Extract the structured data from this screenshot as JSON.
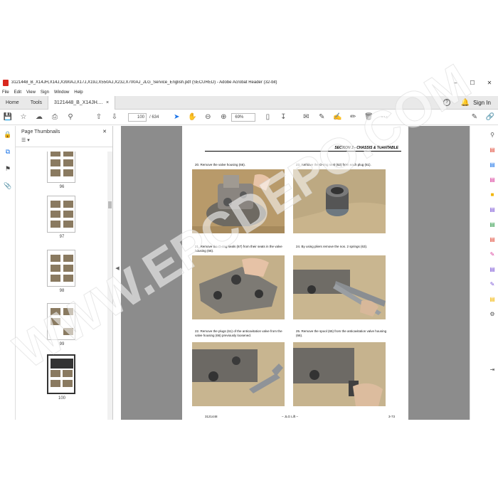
{
  "window": {
    "title": "3121448_B_X14JH,X14J,X390AJ,X17J,X19J,X550AJ,X23J,X700AJ_JLG_Service_English.pdf (SECURED) - Adobe Acrobat Reader (32-bit)",
    "minimize": "–",
    "maximize": "☐",
    "close": "✕"
  },
  "menu": [
    "File",
    "Edit",
    "View",
    "Sign",
    "Window",
    "Help"
  ],
  "tabs": {
    "home": "Home",
    "tools": "Tools",
    "doc": "3121448_B_X14JH....",
    "doc_close": "×",
    "help": "?",
    "signin": "Sign In"
  },
  "toolbar": {
    "page_current": "100",
    "page_total": "/ 634",
    "zoom": "69%"
  },
  "thumbnails": {
    "title": "Page Thumbnails",
    "close": "✕",
    "options": "☰ ▾",
    "pages": [
      "96",
      "97",
      "98",
      "99",
      "100"
    ]
  },
  "document": {
    "section": "SECTION 3 - CHASSIS & TURNTABLE",
    "steps": [
      {
        "text": "20. Remove the valve housing (66)."
      },
      {
        "text": "23. Remove the O-ring seal (62) from each plug (61)."
      },
      {
        "text": "21. Remove the O-ring seals (67) from their seats in the valve housing (66)."
      },
      {
        "text": "24. By using pliers remove the nos. 2 springs (63)."
      },
      {
        "text": "22. Remove the plugs (61) of the anticavitation valve from the valve housing (66) previously loosened."
      },
      {
        "text": "25. Remove the spool (65) from the anticavitation valve housing (66)."
      }
    ],
    "footer_left": "3121448",
    "footer_center": "– JLG Lift –",
    "footer_right": "3-73"
  },
  "watermark": "WWW.EPCDEPO.COM",
  "colors": {
    "accent": "#1a73e8",
    "pdf_red": "#d9281e",
    "viewer_bg": "#8c8c8c"
  }
}
